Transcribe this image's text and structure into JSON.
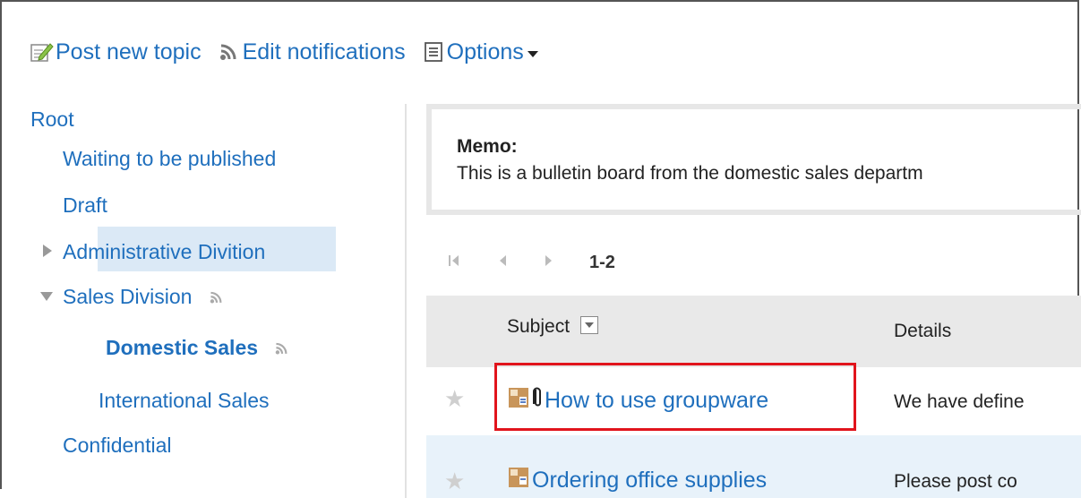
{
  "toolbar": {
    "post_label": "Post new topic",
    "post_icon": "post-edit-icon",
    "notify_label": "Edit notifications",
    "notify_icon": "feed-icon",
    "options_label": "Options",
    "options_icon": "list-icon"
  },
  "tree": {
    "root": "Root",
    "waiting": "Waiting to be published",
    "draft": "Draft",
    "admin": "Administrative Divition",
    "sales": "Sales Division",
    "domestic": "Domestic Sales",
    "international": "International Sales",
    "confidential": "Confidential"
  },
  "memo": {
    "title": "Memo:",
    "text": "This is a bulletin board from the domestic sales departm"
  },
  "pager": {
    "range": "1-2"
  },
  "table": {
    "headers": {
      "subject": "Subject",
      "details": "Details"
    },
    "rows": [
      {
        "subject": "How to use groupware",
        "details": "We have define",
        "has_attachment": true
      },
      {
        "subject": "Ordering office supplies",
        "details": "Please post co",
        "has_attachment": false
      }
    ]
  },
  "colors": {
    "link": "#1f6fbd",
    "highlight": "#e1141c",
    "selected": "#dbe9f6"
  }
}
